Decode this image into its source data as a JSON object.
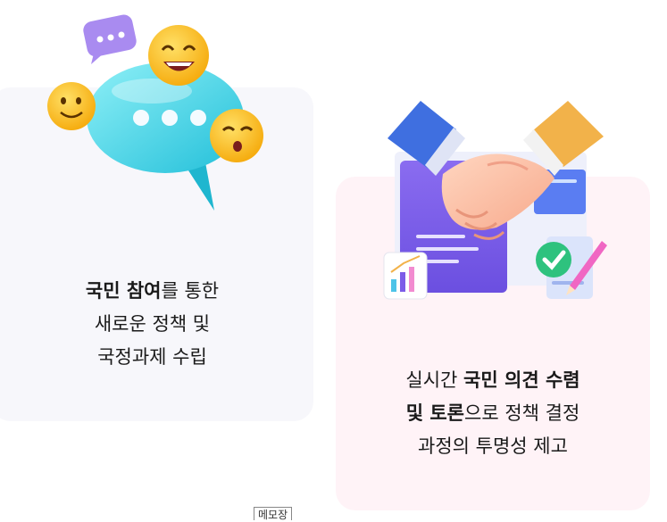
{
  "cards": [
    {
      "illustration": "chat-bubble-emoji-illustration",
      "line1_bold": "국민 참여",
      "line1_rest": "를 통한",
      "line2": "새로운 정책 및",
      "line3": "국정과제 수립"
    },
    {
      "illustration": "handshake-document-illustration",
      "line1_normal": "실시간 ",
      "line1_bold": "국민 의견 수렴",
      "line2_bold": "및 토론",
      "line2_rest": "으로 정책 결정",
      "line3": "과정의 투명성 제고"
    }
  ],
  "memo_label": "메모장",
  "colors": {
    "left_card_bg": "#f7f7fb",
    "right_card_bg": "#fff3f7",
    "bubble": "#4fd2e6",
    "emoji": "#ffc21a",
    "doc": "#7c5ce8",
    "check": "#2ec27e"
  }
}
